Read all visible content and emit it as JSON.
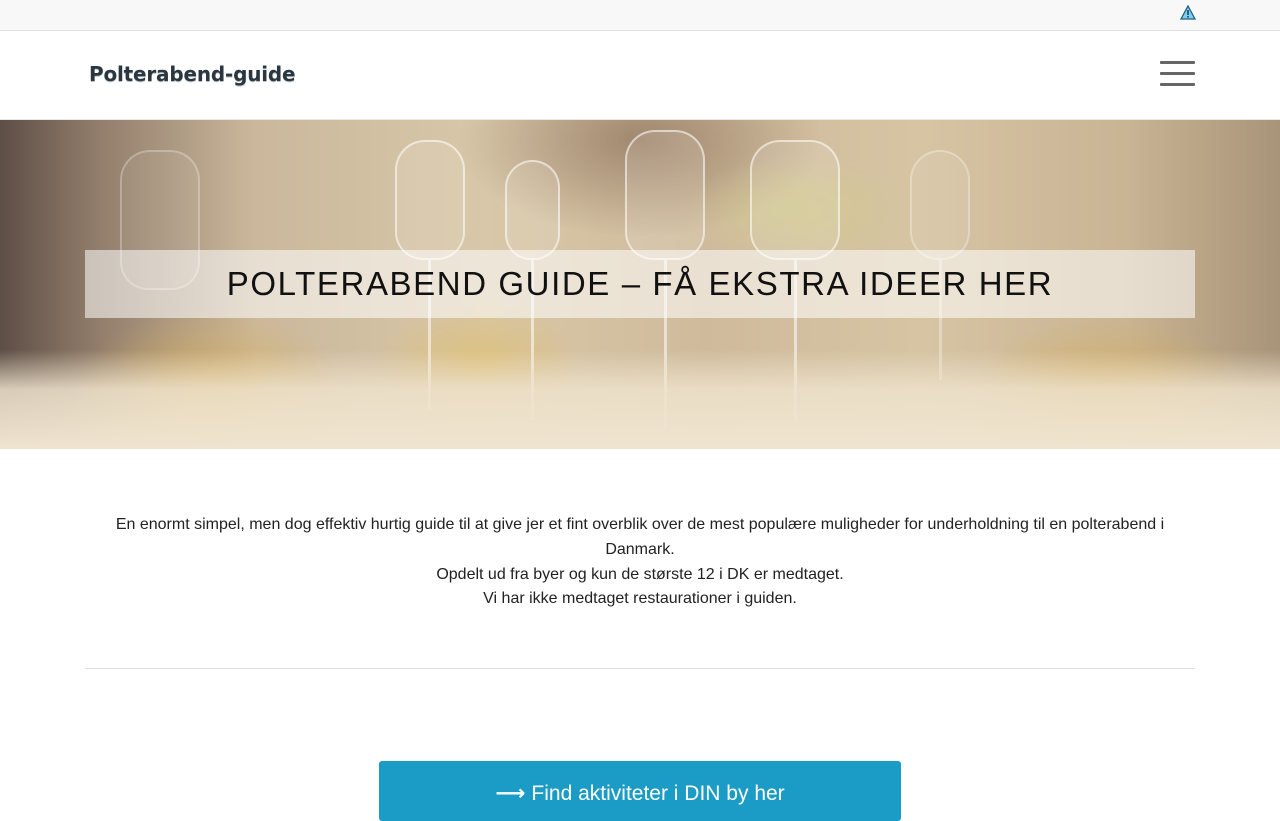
{
  "topbar": {
    "warning_icon": "warning-triangle-icon",
    "warning_color": "#1e8bc3"
  },
  "header": {
    "logo_text": "Polterabend-guide",
    "menu_icon": "hamburger-menu-icon"
  },
  "hero": {
    "title": "POLTERABEND GUIDE – FÅ EKSTRA IDEER HER",
    "image": "restaurant-table-setting-photo"
  },
  "intro": {
    "line1": "En enormt simpel, men dog effektiv hurtig guide til at give jer et fint overblik over de mest populære muligheder for underholdning til en polterabend i Danmark.",
    "line2": "Opdelt ud fra byer og kun de største 12 i DK er medtaget.",
    "line3": "Vi har ikke medtaget restaurationer i guiden."
  },
  "cta": {
    "icon": "arrow-right-icon",
    "arrow_glyph": "⟶",
    "label": "Find aktiviteter i DIN by her",
    "color": "#1b9cc6"
  }
}
